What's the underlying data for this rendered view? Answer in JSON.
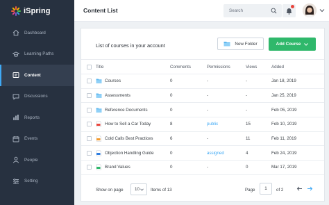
{
  "app": {
    "name": "iSpring"
  },
  "sidebar": {
    "items": [
      {
        "label": "Dashboard",
        "icon": "dashboard-icon"
      },
      {
        "label": "Learning Paths",
        "icon": "graduation-cap-icon"
      },
      {
        "label": "Content",
        "icon": "content-icon"
      },
      {
        "label": "Discussions",
        "icon": "chat-icon"
      },
      {
        "label": "Reports",
        "icon": "bar-chart-icon"
      },
      {
        "label": "Events",
        "icon": "calendar-icon"
      },
      {
        "label": "People",
        "icon": "people-icon"
      },
      {
        "label": "Setting",
        "icon": "sliders-icon"
      }
    ],
    "active_index": 2
  },
  "header": {
    "title": "Content List",
    "search_placeholder": "Search"
  },
  "card": {
    "title": "List of courses in your account",
    "new_folder_label": "New Folder",
    "add_course_label": "Add Course"
  },
  "table": {
    "columns": {
      "title": "Title",
      "comments": "Comments",
      "permissions": "Permissions",
      "views": "Views",
      "added": "Added"
    },
    "rows": [
      {
        "title": "Courses",
        "type": "folder",
        "comments": "0",
        "permissions": "-",
        "views": "-",
        "added": "Jan 18, 2019"
      },
      {
        "title": "Assessments",
        "type": "folder",
        "comments": "0",
        "permissions": "-",
        "views": "-",
        "added": "Jan 25, 2019"
      },
      {
        "title": "Reference Documents",
        "type": "folder",
        "comments": "0",
        "permissions": "-",
        "views": "-",
        "added": "Feb 05, 2019"
      },
      {
        "title": "How to Sell a Car Today",
        "type": "pdf",
        "comments": "8",
        "permissions": "public",
        "views": "15",
        "added": "Feb 10, 2019"
      },
      {
        "title": "Cold Calls Best Practices",
        "type": "presentation",
        "comments": "6",
        "permissions": "-",
        "views": "11",
        "added": "Feb 11, 2019"
      },
      {
        "title": "Objection Handling Guide",
        "type": "doc",
        "comments": "0",
        "permissions": "assigned",
        "views": "4",
        "added": "Feb 24, 2019"
      },
      {
        "title": "Brand Values",
        "type": "image",
        "comments": "0",
        "permissions": "-",
        "views": "0",
        "added": "Mar 17, 2019"
      }
    ]
  },
  "footer": {
    "show_on_page_label": "Show on page",
    "page_size": "10",
    "items_of_label": "Items of 13",
    "page_label": "Page",
    "page_current": "1",
    "of_pages_label": "of 2"
  },
  "colors": {
    "sidebar_bg": "#273140",
    "accent_green": "#2fb86b",
    "link_blue": "#3fa9f5",
    "notification_red": "#e8453c"
  }
}
